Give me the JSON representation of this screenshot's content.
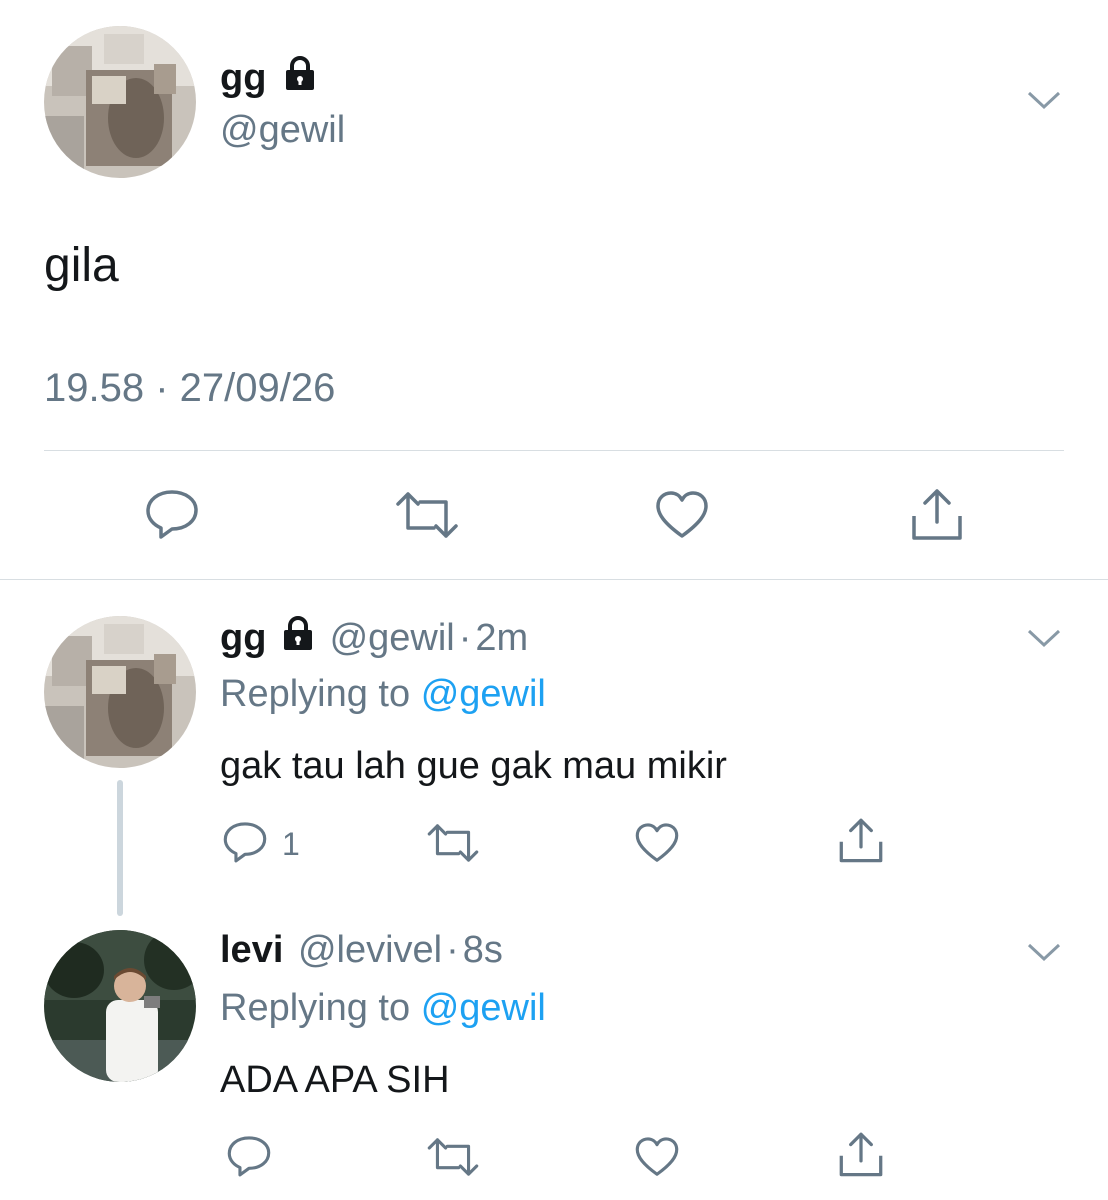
{
  "main_tweet": {
    "display_name": "gg",
    "handle": "@gewil",
    "text": "gila",
    "timestamp": "19.58 · 27/09/26",
    "lock_icon": "lock-icon",
    "caret_icon": "chevron-down-icon"
  },
  "replies": [
    {
      "display_name": "gg",
      "handle": "@gewil",
      "time": "2m",
      "replying_prefix": "Replying to",
      "replying_handle": "@gewil",
      "text": "gak tau lah gue gak mau mikir",
      "reply_count": "1"
    },
    {
      "display_name": "levi",
      "handle": "@levivel",
      "time": "8s",
      "replying_prefix": "Replying to",
      "replying_handle": "@gewil",
      "text": "ADA APA SIH",
      "reply_count": ""
    }
  ],
  "separator": "·",
  "icons": [
    "reply-icon",
    "retweet-icon",
    "like-icon",
    "share-icon",
    "lock-icon",
    "chevron-down-icon"
  ],
  "colors": {
    "text": "#14171a",
    "secondary": "#657786",
    "link": "#1da1f2",
    "divider": "#d8dee2"
  }
}
